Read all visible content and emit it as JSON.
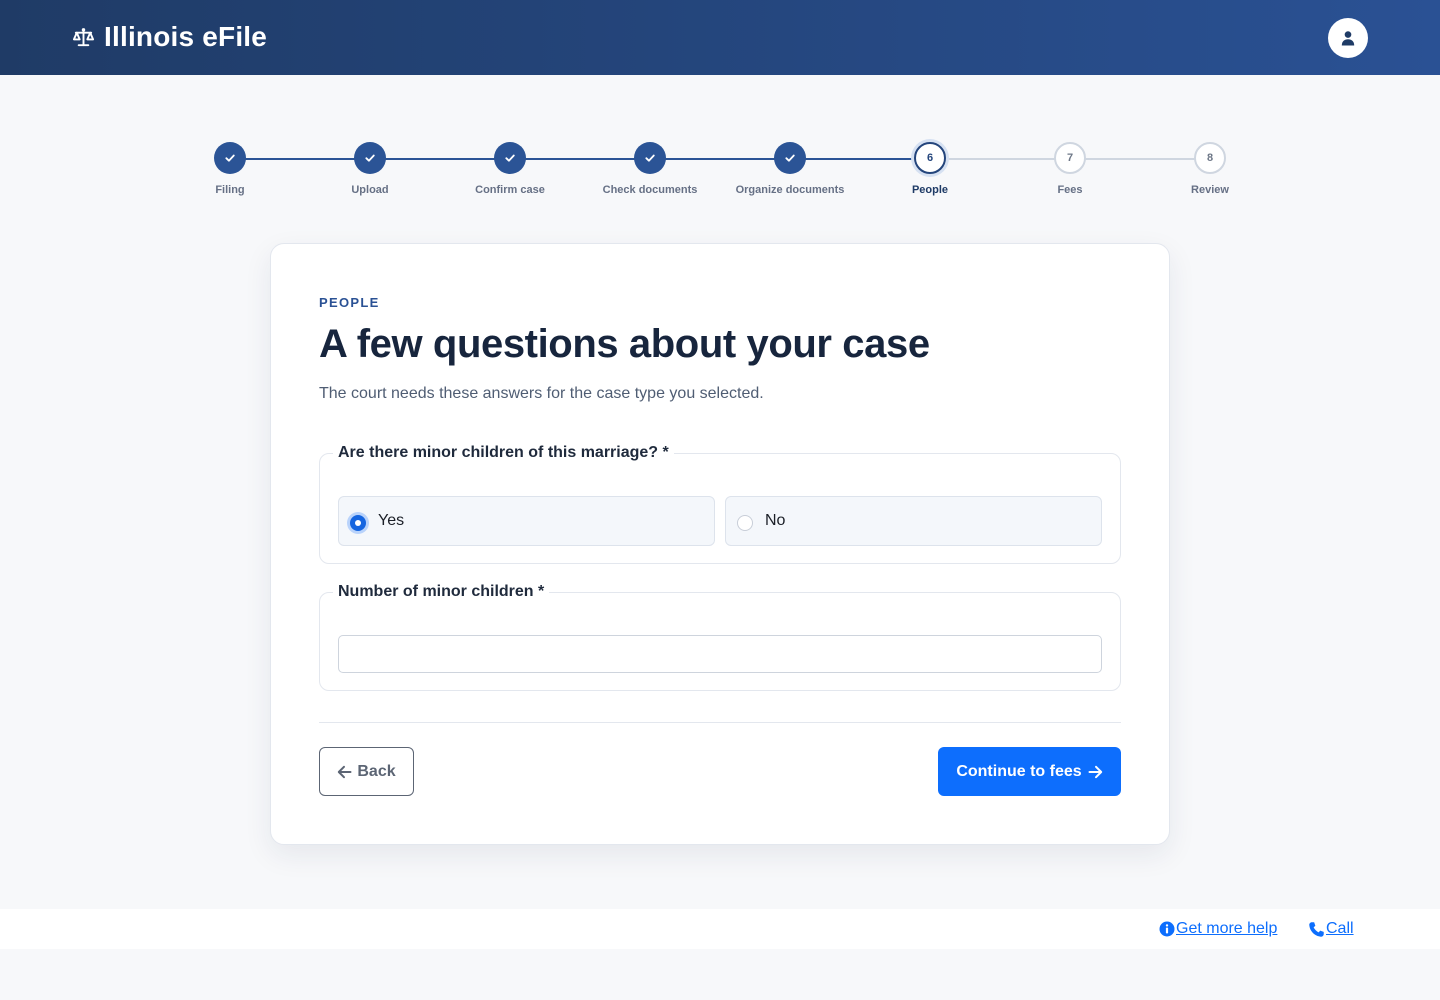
{
  "header": {
    "brand_icon": "scale-balance-icon",
    "brand_title": "Illinois eFile",
    "avatar_icon": "user-icon"
  },
  "stepper": {
    "current_step": 6,
    "steps": [
      {
        "number": "1",
        "label": "Filing",
        "status": "done"
      },
      {
        "number": "2",
        "label": "Upload",
        "status": "done"
      },
      {
        "number": "3",
        "label": "Confirm case",
        "status": "done"
      },
      {
        "number": "4",
        "label": "Check documents",
        "status": "done"
      },
      {
        "number": "5",
        "label": "Organize documents",
        "status": "done"
      },
      {
        "number": "6",
        "label": "People",
        "status": "current"
      },
      {
        "number": "7",
        "label": "Fees",
        "status": "todo"
      },
      {
        "number": "8",
        "label": "Review",
        "status": "todo"
      }
    ]
  },
  "card": {
    "eyebrow": "PEOPLE",
    "title": "A few questions about your case",
    "subtitle": "The court needs these answers for the case type you selected."
  },
  "questions": {
    "minor_children": {
      "legend": "Are there minor children of this marriage? *",
      "options": [
        {
          "label": "Yes",
          "selected": true
        },
        {
          "label": "No",
          "selected": false
        }
      ]
    },
    "number_children": {
      "legend": "Number of minor children *",
      "value": "",
      "placeholder": ""
    }
  },
  "actions": {
    "back_label": "Back",
    "continue_label": "Continue to fees"
  },
  "footer": {
    "help_label": "Get more help",
    "call_label": "Call"
  },
  "colors": {
    "header_start": "#1f3b66",
    "header_end": "#2a5194",
    "primary": "#0d6efd",
    "step_done": "#2b5496",
    "step_todo_border": "#cfd6e0"
  }
}
